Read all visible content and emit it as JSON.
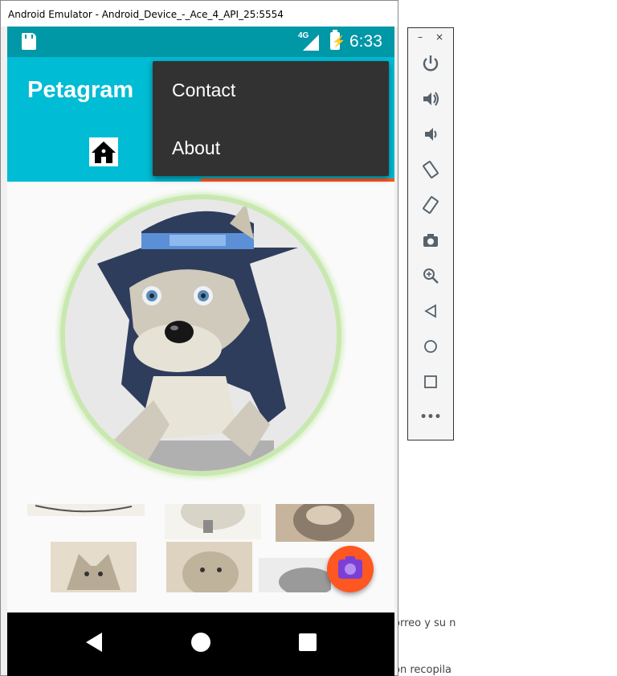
{
  "window": {
    "title": "Android Emulator - Android_Device_-_Ace_4_API_25:5554"
  },
  "status_bar": {
    "network": "4G",
    "time": "6:33",
    "icons": [
      "sd-card-icon",
      "signal-icon",
      "battery-charging-icon"
    ]
  },
  "app_bar": {
    "title": "Petagram",
    "tabs": [
      {
        "icon": "home-icon",
        "selected": false
      },
      {
        "icon": "profile-tab",
        "selected": true
      }
    ],
    "accent_color": "#ff5722",
    "primary_color": "#00bcd4",
    "status_color": "#0097a7"
  },
  "overflow_menu": {
    "items": [
      {
        "label": "Contact"
      },
      {
        "label": "About"
      }
    ]
  },
  "profile": {
    "avatar": "husky-pixel-art-avatar"
  },
  "gallery": {
    "thumbnails": [
      "dog-sketch-1",
      "dog-sketch-2",
      "dog-sketch-3",
      "husky-sketch",
      "pitbull-sketch",
      "dog-sketch-6"
    ]
  },
  "fab": {
    "icon": "camera-icon"
  },
  "nav_bar": {
    "icons": [
      "back-icon",
      "home-circle-icon",
      "recents-icon"
    ]
  },
  "emulator_toolbar": {
    "window_buttons": [
      "–",
      "×"
    ],
    "tools": [
      "power-icon",
      "volume-up-icon",
      "volume-down-icon",
      "rotate-left-icon",
      "rotate-right-icon",
      "screenshot-icon",
      "zoom-icon",
      "back-icon",
      "home-icon",
      "overview-icon",
      "more-icon"
    ],
    "more_label": "•••"
  },
  "background_text": {
    "line1": "orreo y su n",
    "line2": "ón recopila"
  }
}
